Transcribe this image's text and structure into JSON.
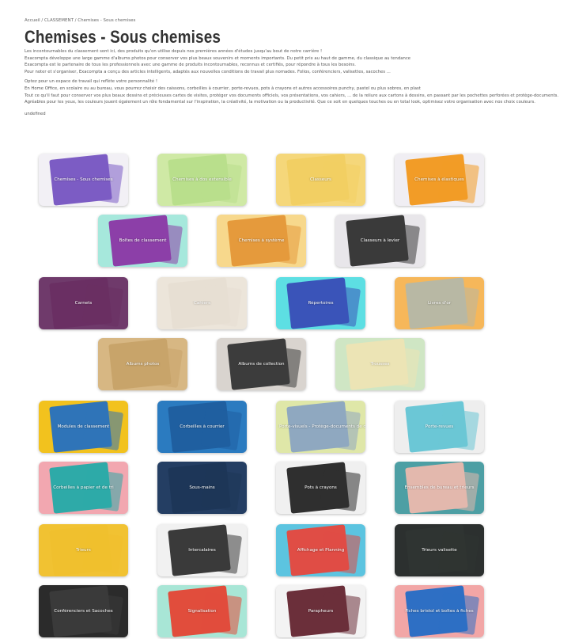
{
  "breadcrumb": "Accueil / CLASSEMENT / Chemises - Sous chemises",
  "page_title": "Chemises - Sous chemises",
  "intro": [
    "Les incontournables du classement sont ici, des produits qu'on utilise depuis nos premières années d'études jusqu'au bout de notre carrière !",
    "Exacompta développe une large gamme d'albums photos pour conserver vos plus beaux souvenirs et moments importants. Du petit prix au haut de gamme, du classique au tendance",
    "Exacompta est le partenaire de tous les professionnels avec une gamme de produits incontournables, reconnus et certifiés, pour répondre à tous les besoins.",
    "Pour noter et s'organiser, Exacompta a conçu des articles intelligents, adaptés aux nouvelles conditions de travail plus nomades. Folios, conférenciers, valisettes, sacoches ...",
    "Optez pour un espace de travail qui reflète votre personnalité !",
    "En Home Office, en scolaire ou au bureau, vous pourrez choisir des caissons, corbeilles à courrier, porte-revues, pots à crayons et autres accessoires punchy, pastel ou plus sobres, en plast",
    "Tout ce qu'il faut pour conserver vos plus beaux dessins et précieuses cartes de visites, protéger vos documents officiels, vos présentations, vos cahiers, ... de la reliure aux cartons à dessins, en passant par les pochettes perforées et protège-documents.",
    "Agréables pour les yeux, les couleurs jouent également un rôle fondamental sur l'inspiration, la créativité, la motivation ou la productivité. Que ce soit en quelques touches ou en total look, optimisez votre organisation avec nos choix couleurs.",
    "undefined"
  ],
  "categories": [
    {
      "label": "Chemises - Sous chemises",
      "color": "#7c5cc4",
      "bg": "#f2f0f5"
    },
    {
      "label": "Chemises à dos extensible",
      "color": "#b9df8c",
      "bg": "#cfe9a5"
    },
    {
      "label": "Classeurs",
      "color": "#f2cf63",
      "bg": "#f5d77a"
    },
    {
      "label": "Chemises à élastiques",
      "color": "#f29c27",
      "bg": "#f0eef3"
    },
    {
      "label": "Boîtes de classement",
      "color": "#8c3fa8",
      "bg": "#a6e8dc"
    },
    {
      "label": "Chemises à système",
      "color": "#e59a3c",
      "bg": "#f7d88c"
    },
    {
      "label": "Classeurs à levier",
      "color": "#3a3a3a",
      "bg": "#e8e6ea"
    },
    {
      "label": "Carnets",
      "color": "#6a2f63",
      "bg": "#6f3a6b"
    },
    {
      "label": "Cahiers",
      "color": "#e7dfd3",
      "bg": "#ece5da"
    },
    {
      "label": "Répertoires",
      "color": "#3a54b9",
      "bg": "#5ddfe3"
    },
    {
      "label": "Livres d'or",
      "color": "#b8b8a4",
      "bg": "#f6b75a"
    },
    {
      "label": "Albums photos",
      "color": "#c8a46a",
      "bg": "#d7b783"
    },
    {
      "label": "Albums de collection",
      "color": "#3c3c3c",
      "bg": "#d9d4cf"
    },
    {
      "label": "Trousses",
      "color": "#ece4b5",
      "bg": "#cfe6c4"
    },
    {
      "label": "Modules de classement",
      "color": "#2f74b8",
      "bg": "#f2c21e"
    },
    {
      "label": "Corbeilles à courrier",
      "color": "#1f5fa0",
      "bg": "#2b7bc0"
    },
    {
      "label": "Porte-visuels - Protège-documents de d...",
      "color": "#8fa8c0",
      "bg": "#dfe7a8"
    },
    {
      "label": "Porte-revues",
      "color": "#6bc7d6",
      "bg": "#eeeeee"
    },
    {
      "label": "Corbeilles à papier et de tri",
      "color": "#2eaaa8",
      "bg": "#f2a7b0"
    },
    {
      "label": "Sous-mains",
      "color": "#1d3658",
      "bg": "#243e63"
    },
    {
      "label": "Pots à crayons",
      "color": "#2f2f2f",
      "bg": "#f0f0f0"
    },
    {
      "label": "Ensembles de bureau et trieurs",
      "color": "#e3b8ad",
      "bg": "#4d9fa4"
    },
    {
      "label": "Trieurs",
      "color": "#f0c02e",
      "bg": "#f1c232"
    },
    {
      "label": "Intercalaires",
      "color": "#3a3a3a",
      "bg": "#f1f1f1"
    },
    {
      "label": "Affichage et Planning",
      "color": "#e04d45",
      "bg": "#5cc4e0"
    },
    {
      "label": "Trieurs valisette",
      "color": "#2f3432",
      "bg": "#2c302f"
    },
    {
      "label": "Conférenciers et Sacoches",
      "color": "#3a3a3a",
      "bg": "#2b2b2b"
    },
    {
      "label": "Signalisation",
      "color": "#e14d3c",
      "bg": "#a8e6d6"
    },
    {
      "label": "Parapheurs",
      "color": "#6b2f3a",
      "bg": "#f3f3f3"
    },
    {
      "label": "Fiches bristol et boîtes à fiches",
      "color": "#2e6fc4",
      "bg": "#f2a6a6"
    }
  ]
}
